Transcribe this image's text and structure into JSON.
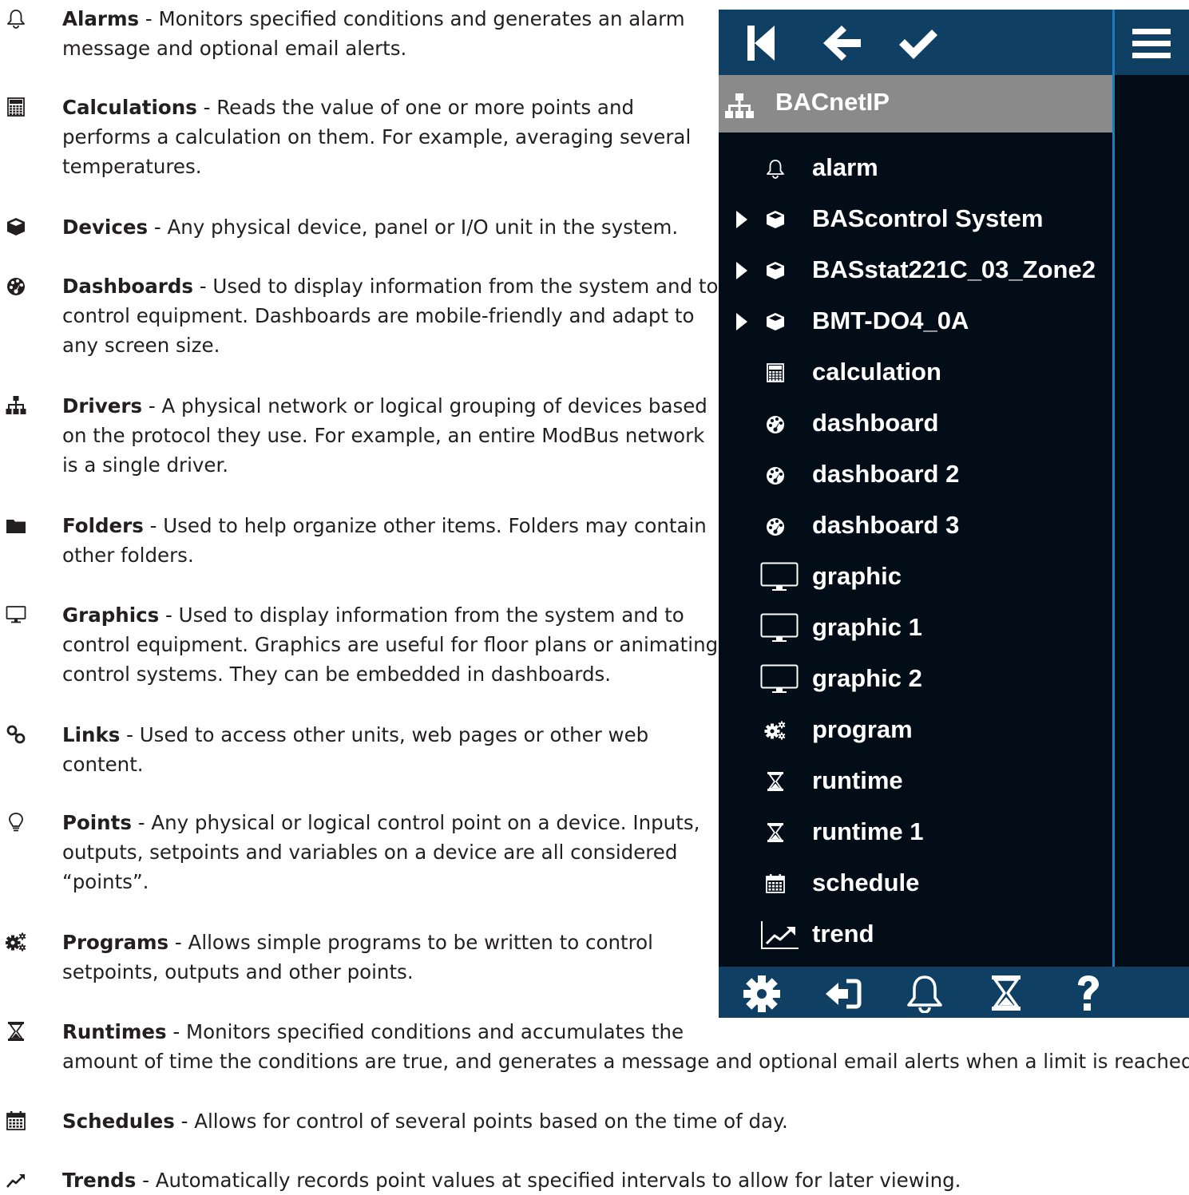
{
  "legend": [
    {
      "icon": "bell-icon",
      "title": "Alarms",
      "lines": [
        "Alarms - Monitors specified conditions and generates an alarm",
        "message and optional email alerts."
      ]
    },
    {
      "icon": "calculator-icon",
      "title": "Calculations",
      "lines": [
        "Calculations - Reads the value of one or more points and",
        "performs a calculation on them. For example, averaging several",
        "temperatures."
      ]
    },
    {
      "icon": "cube-icon",
      "title": "Devices",
      "lines": [
        "Devices - Any physical device, panel or I/O unit in the system."
      ]
    },
    {
      "icon": "dashboard-icon",
      "title": "Dashboards",
      "lines": [
        "Dashboards - Used to display information from the system and to",
        "control equipment. Dashboards are mobile-friendly and adapt to",
        "any screen size."
      ]
    },
    {
      "icon": "sitemap-icon",
      "title": "Drivers",
      "lines": [
        "Drivers - A physical network or logical grouping of devices based",
        "on the protocol they use. For example, an entire ModBus network",
        "is a single driver."
      ]
    },
    {
      "icon": "folder-icon",
      "title": "Folders",
      "lines": [
        "Folders - Used to help organize other items. Folders may contain",
        "other folders."
      ]
    },
    {
      "icon": "monitor-icon",
      "title": "Graphics",
      "lines": [
        "Graphics - Used to display information from the system and to",
        "control equipment. Graphics are useful for floor plans or animating",
        "control systems. They can be embedded in dashboards."
      ]
    },
    {
      "icon": "link-icon",
      "title": "Links",
      "lines": [
        "Links - Used to access other units, web pages or other web",
        "content."
      ]
    },
    {
      "icon": "lightbulb-icon",
      "title": "Points",
      "lines": [
        "Points - Any physical or logical control point on a device. Inputs,",
        "outputs, setpoints and variables on a device are all considered",
        "“points”."
      ]
    },
    {
      "icon": "gears-icon",
      "title": "Programs",
      "lines": [
        "Programs - Allows simple programs to be written to control",
        "setpoints, outputs and other points."
      ]
    },
    {
      "icon": "hourglass-icon",
      "title": "Runtimes",
      "lines": [
        "Runtimes - Monitors specified conditions and accumulates the",
        "amount of time the conditions are true, and generates a message and optional email alerts when a limit is reached."
      ]
    },
    {
      "icon": "calendar-icon",
      "title": "Schedules",
      "lines": [
        "Schedules - Allows for control of several points based on the time of day."
      ]
    },
    {
      "icon": "trend-icon",
      "title": "Trends",
      "lines": [
        "Trends - Automatically records point values at specified intervals to allow for later viewing."
      ]
    }
  ],
  "toolbar": {
    "icons": [
      "first-icon",
      "back-arrow-icon",
      "checkmark-icon",
      "hamburger-menu-icon"
    ]
  },
  "tree": {
    "root_label": "BACnetIP",
    "items": [
      {
        "label": "alarm",
        "icon": "bell-icon",
        "expandable": false
      },
      {
        "label": "BAScontrol System",
        "icon": "cube-icon",
        "expandable": true
      },
      {
        "label": "BASstat221C_03_Zone2",
        "icon": "cube-icon",
        "expandable": true
      },
      {
        "label": "BMT-DO4_0A",
        "icon": "cube-icon",
        "expandable": true
      },
      {
        "label": "calculation",
        "icon": "calculator-icon",
        "expandable": false
      },
      {
        "label": "dashboard",
        "icon": "dashboard-icon",
        "expandable": false
      },
      {
        "label": "dashboard 2",
        "icon": "dashboard-icon",
        "expandable": false
      },
      {
        "label": "dashboard 3",
        "icon": "dashboard-icon",
        "expandable": false
      },
      {
        "label": "graphic",
        "icon": "monitor-icon",
        "expandable": false
      },
      {
        "label": "graphic 1",
        "icon": "monitor-icon",
        "expandable": false
      },
      {
        "label": "graphic 2",
        "icon": "monitor-icon",
        "expandable": false
      },
      {
        "label": "program",
        "icon": "gears-icon",
        "expandable": false
      },
      {
        "label": "runtime",
        "icon": "hourglass-icon",
        "expandable": false
      },
      {
        "label": "runtime 1",
        "icon": "hourglass-icon",
        "expandable": false
      },
      {
        "label": "schedule",
        "icon": "calendar-icon",
        "expandable": false
      },
      {
        "label": "trend",
        "icon": "trend-icon",
        "expandable": false
      }
    ]
  },
  "bottom_toolbar": {
    "icons": [
      "gear-icon",
      "sign-in-icon",
      "bell-icon",
      "hourglass-icon",
      "question-icon"
    ]
  },
  "colors": {
    "panel_bg": "#020d18",
    "toolbar_bg": "#0f3f63",
    "accent": "#1b7cc1",
    "selected_bg": "#8a8a8a"
  }
}
